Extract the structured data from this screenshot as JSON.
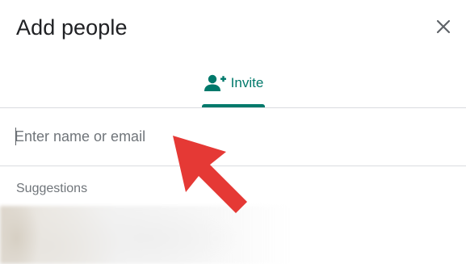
{
  "dialog": {
    "title": "Add people",
    "close_icon": "close-icon"
  },
  "tabs": [
    {
      "label": "Invite",
      "icon": "person-add-icon",
      "active": true
    }
  ],
  "search": {
    "value": "",
    "placeholder": "Enter name or email"
  },
  "suggestions": {
    "label": "Suggestions"
  },
  "colors": {
    "accent": "#00796b",
    "arrow": "#e53935",
    "divider": "#dadce0",
    "text": "#202124",
    "muted": "#70757a"
  }
}
